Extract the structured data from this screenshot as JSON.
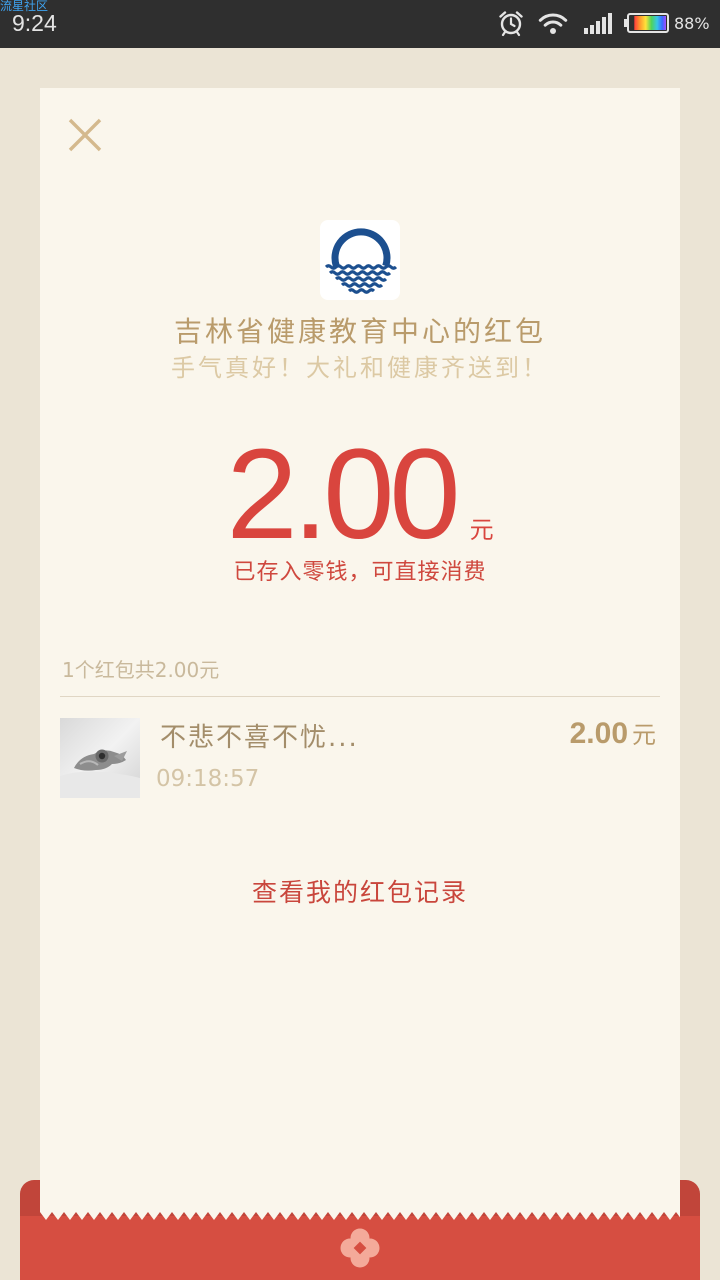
{
  "status_bar": {
    "watermark": "流星社区",
    "time": "9:24",
    "battery_text": "88%",
    "battery_level": 0.88,
    "icons": {
      "alarm": "alarm-clock-icon",
      "wifi": "wifi-icon",
      "signal": "cellular-signal-icon",
      "battery": "battery-icon"
    }
  },
  "red_packet": {
    "close_icon": "close-icon",
    "sender_logo_icon": "sender-logo-icon",
    "title": "吉林省健康教育中心的红包",
    "blessing": "手气真好！大礼和健康齐送到！",
    "amount": "2.00",
    "currency": "元",
    "deposit_note": "已存入零钱，可直接消费"
  },
  "summary": "1个红包共2.00元",
  "receivers": [
    {
      "name": "不悲不喜不忧...",
      "time": "09:18:57",
      "amount": "2.00",
      "currency": "元"
    }
  ],
  "records_link": "查看我的红包记录",
  "footer": {
    "emblem_icon": "red-packet-emblem-icon"
  },
  "colors": {
    "page_bg": "#ebe4d5",
    "status_bg": "#2f2f2f",
    "watermark_blue": "#3ea3f0",
    "card_bg": "#faf6ec",
    "gold": "#b99b6b",
    "gold_light": "#dcc9a4",
    "gold_muted": "#c9b99c",
    "name_gold": "#a38d6a",
    "time_gold": "#d4c4a6",
    "close_gold": "#d4b98d",
    "divider": "#e0d6c4",
    "accent_red": "#d9453e",
    "note_red": "#cf483e",
    "link_red": "#c9463c",
    "envelope_red": "#d64e41",
    "envelope_red_dark": "#c1453a",
    "emblem_pink": "#f4aa9a",
    "logo_blue": "#1c4f8f"
  }
}
